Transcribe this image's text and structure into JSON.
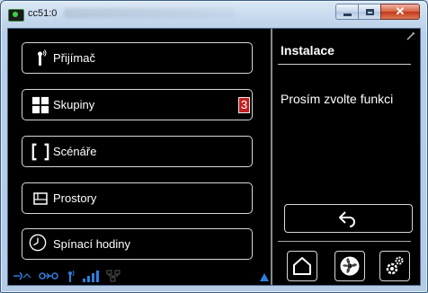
{
  "window": {
    "title": "cc51:0",
    "close_glyph": "✕"
  },
  "menu": {
    "items": [
      {
        "label": "Přijímač",
        "icon": "antenna-icon"
      },
      {
        "label": "Skupiny",
        "icon": "grid-icon",
        "badge": "3"
      },
      {
        "label": "Scénáře",
        "icon": "brackets-icon"
      },
      {
        "label": "Prostory",
        "icon": "room-icon"
      },
      {
        "label": "Spínací hodiny",
        "icon": "clock-icon"
      }
    ]
  },
  "panel": {
    "title": "Instalace",
    "message": "Prosím zvolte funkci"
  },
  "colors": {
    "background": "#000000",
    "text": "#ffffff",
    "badge": "#c21f1f",
    "status_blue": "#2f7fe0",
    "status_green": "#3fd13f"
  }
}
